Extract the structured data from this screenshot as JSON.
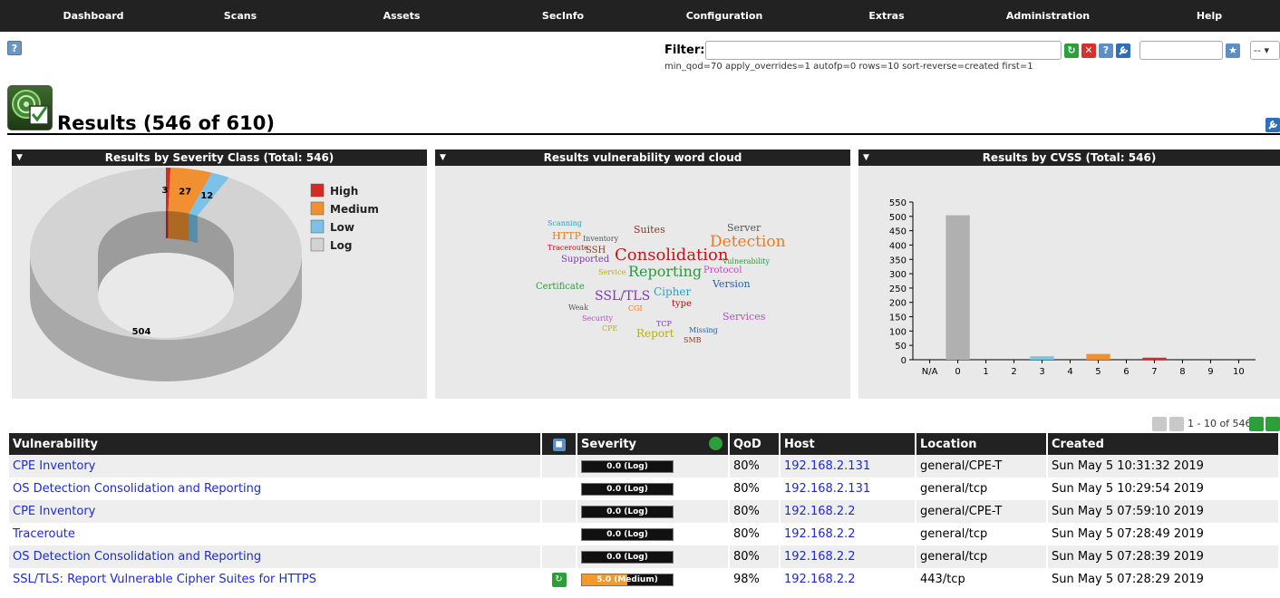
{
  "nav": [
    "Dashboard",
    "Scans",
    "Assets",
    "SecInfo",
    "Configuration",
    "Extras",
    "Administration",
    "Help"
  ],
  "filter": {
    "label": "Filter:",
    "value": "",
    "text": "min_qod=70 apply_overrides=1 autofp=0 rows=10 sort-reverse=created first=1",
    "select_value": "--"
  },
  "page_title": "Results (546 of 610)",
  "panels": {
    "severity_title": "Results by Severity Class (Total: 546)",
    "wordcloud_title": "Results vulnerability word cloud",
    "cvss_title": "Results by CVSS (Total: 546)"
  },
  "severity_chart": {
    "type": "pie",
    "legend": [
      "High",
      "Medium",
      "Low",
      "Log"
    ],
    "values": [
      3,
      27,
      12,
      504
    ],
    "colors": [
      "#d62a25",
      "#f09030",
      "#7cc2e8",
      "#d3d3d3"
    ]
  },
  "wordcloud": [
    {
      "text": "Scanning",
      "color": "#2ca0c8"
    },
    {
      "text": "HTTP",
      "color": "#ee7a1a"
    },
    {
      "text": "Inventory",
      "color": "#555555"
    },
    {
      "text": "Suites",
      "color": "#8a3a2a"
    },
    {
      "text": "Server",
      "color": "#555555"
    },
    {
      "text": "Traceroute",
      "color": "#c01010"
    },
    {
      "text": "SSH",
      "color": "#8a3a2a"
    },
    {
      "text": "Consolidation",
      "color": "#c81414"
    },
    {
      "text": "Detection",
      "color": "#ee7a1a"
    },
    {
      "text": "Supported",
      "color": "#7b3bb8"
    },
    {
      "text": "Reporting",
      "color": "#2a9a3a"
    },
    {
      "text": "Vulnerability",
      "color": "#2a9a3a"
    },
    {
      "text": "Service",
      "color": "#b8b010"
    },
    {
      "text": "Protocol",
      "color": "#c04ac0"
    },
    {
      "text": "Certificate",
      "color": "#2a9a3a"
    },
    {
      "text": "Version",
      "color": "#2060a8"
    },
    {
      "text": "SSL/TLS",
      "color": "#7b3bb8"
    },
    {
      "text": "Cipher",
      "color": "#2ca0c8"
    },
    {
      "text": "type",
      "color": "#c01010"
    },
    {
      "text": "Weak",
      "color": "#555555"
    },
    {
      "text": "CGI",
      "color": "#ee7a1a"
    },
    {
      "text": "Services",
      "color": "#c04ac0"
    },
    {
      "text": "Security",
      "color": "#c04ac0"
    },
    {
      "text": "TCP",
      "color": "#7b3bb8"
    },
    {
      "text": "CPE",
      "color": "#b8b010"
    },
    {
      "text": "Report",
      "color": "#b8b010"
    },
    {
      "text": "Missing",
      "color": "#2060a8"
    },
    {
      "text": "SMB",
      "color": "#8a3a2a"
    }
  ],
  "chart_data": {
    "type": "bar",
    "title": "Results by CVSS (Total: 546)",
    "categories": [
      "N/A",
      "0",
      "1",
      "2",
      "3",
      "4",
      "5",
      "6",
      "7",
      "8",
      "9",
      "10"
    ],
    "values": [
      0,
      504,
      0,
      0,
      12,
      0,
      20,
      0,
      7,
      0,
      0,
      0
    ],
    "colors": [
      "#b0b0b0",
      "#b0b0b0",
      "#b0b0b0",
      "#b0b0b0",
      "#7cc2e8",
      "#f09030",
      "#f09030",
      "#f09030",
      "#d62a25",
      "#d62a25",
      "#d62a25",
      "#d62a25"
    ],
    "yticks": [
      0,
      50,
      100,
      150,
      200,
      250,
      300,
      350,
      400,
      450,
      500,
      550
    ],
    "ylim": [
      0,
      550
    ],
    "grid": false
  },
  "pager": {
    "text": "1 - 10 of 546"
  },
  "table": {
    "headers": [
      "Vulnerability",
      "",
      "Severity",
      "QoD",
      "Host",
      "Location",
      "Created"
    ],
    "rows": [
      {
        "vuln": "CPE Inventory",
        "action": false,
        "sev": "0.0 (Log)",
        "sev_fraction": 0,
        "qod": "80%",
        "host": "192.168.2.131",
        "loc": "general/CPE-T",
        "created": "Sun May 5 10:31:32 2019"
      },
      {
        "vuln": "OS Detection Consolidation and Reporting",
        "action": false,
        "sev": "0.0 (Log)",
        "sev_fraction": 0,
        "qod": "80%",
        "host": "192.168.2.131",
        "loc": "general/tcp",
        "created": "Sun May 5 10:29:54 2019"
      },
      {
        "vuln": "CPE Inventory",
        "action": false,
        "sev": "0.0 (Log)",
        "sev_fraction": 0,
        "qod": "80%",
        "host": "192.168.2.2",
        "loc": "general/CPE-T",
        "created": "Sun May 5 07:59:10 2019"
      },
      {
        "vuln": "Traceroute",
        "action": false,
        "sev": "0.0 (Log)",
        "sev_fraction": 0,
        "qod": "80%",
        "host": "192.168.2.2",
        "loc": "general/tcp",
        "created": "Sun May 5 07:28:49 2019"
      },
      {
        "vuln": "OS Detection Consolidation and Reporting",
        "action": false,
        "sev": "0.0 (Log)",
        "sev_fraction": 0,
        "qod": "80%",
        "host": "192.168.2.2",
        "loc": "general/tcp",
        "created": "Sun May 5 07:28:39 2019"
      },
      {
        "vuln": "SSL/TLS: Report Vulnerable Cipher Suites for HTTPS",
        "action": true,
        "sev": "5.0 (Medium)",
        "sev_fraction": 0.5,
        "qod": "98%",
        "host": "192.168.2.2",
        "loc": "443/tcp",
        "created": "Sun May 5 07:28:29 2019"
      }
    ]
  }
}
